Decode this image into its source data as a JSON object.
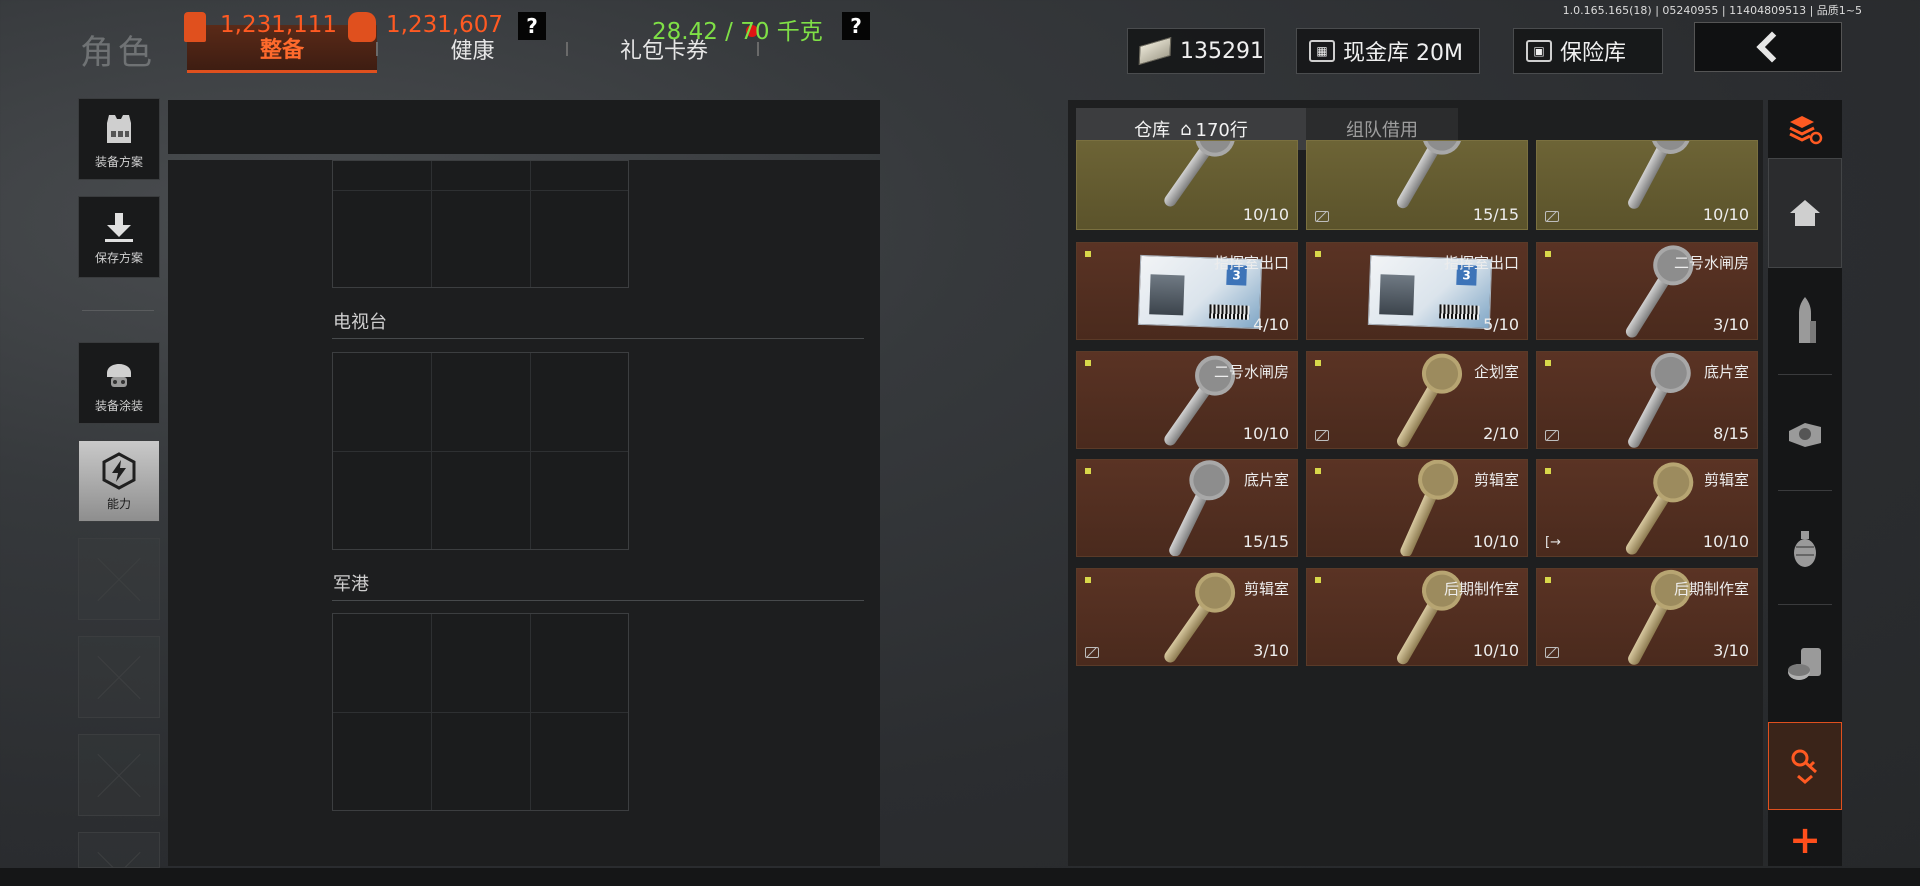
{
  "header": {
    "title": "角色",
    "tabs": [
      {
        "label": "整备",
        "active": true
      },
      {
        "label": "健康",
        "active": false
      },
      {
        "label": "礼包卡券",
        "active": false,
        "notification": true
      }
    ],
    "version": "1.0.165.165(18) | 05240955 | 11404809513 | 品质1~5",
    "currency": "135291",
    "cash_vault": "现金库 20M",
    "safe": "保险库"
  },
  "sidebar": {
    "items": [
      {
        "label": "装备方案",
        "icon": "vest-icon"
      },
      {
        "label": "保存方案",
        "icon": "download-icon"
      },
      {
        "label": "装备涂装",
        "icon": "helmet-icon"
      },
      {
        "label": "能力",
        "icon": "ability-icon",
        "active": true
      }
    ]
  },
  "stats": {
    "gear_value": "1,231,111",
    "bag_value": "1,231,607",
    "weight": "28.42 / 70 千克",
    "help": "?"
  },
  "loadout_sections": [
    {
      "label": "电视台"
    },
    {
      "label": "军港"
    }
  ],
  "warehouse": {
    "tab_storage": "仓库",
    "row_count": "170行",
    "tab_team": "组队借用",
    "items": [
      {
        "name": "",
        "count": "10/10",
        "style": "tan",
        "key": "silver",
        "badge": false
      },
      {
        "name": "",
        "count": "15/15",
        "style": "tan",
        "key": "silver",
        "badge": true
      },
      {
        "name": "",
        "count": "10/10",
        "style": "tan",
        "key": "silver",
        "badge": true
      },
      {
        "name": "指挥室出口",
        "count": "4/10",
        "style": "brown",
        "key": "card",
        "badge": false
      },
      {
        "name": "指挥室出口",
        "count": "5/10",
        "style": "brown",
        "key": "card",
        "badge": false
      },
      {
        "name": "二号水闸房",
        "count": "3/10",
        "style": "brown",
        "key": "silver",
        "badge": false
      },
      {
        "name": "二号水闸房",
        "count": "10/10",
        "style": "brown",
        "key": "silver",
        "badge": false
      },
      {
        "name": "企划室",
        "count": "2/10",
        "style": "brown",
        "key": "gold",
        "badge": true
      },
      {
        "name": "底片室",
        "count": "8/15",
        "style": "brown",
        "key": "silver",
        "badge": true
      },
      {
        "name": "底片室",
        "count": "15/15",
        "style": "brown",
        "key": "silver",
        "badge": false
      },
      {
        "name": "剪辑室",
        "count": "10/10",
        "style": "brown",
        "key": "gold",
        "badge": false
      },
      {
        "name": "剪辑室",
        "count": "10/10",
        "style": "brown",
        "key": "gold",
        "exit": true
      },
      {
        "name": "剪辑室",
        "count": "3/10",
        "style": "brown",
        "key": "gold",
        "badge": true
      },
      {
        "name": "后期制作室",
        "count": "10/10",
        "style": "brown",
        "key": "gold",
        "badge": false
      },
      {
        "name": "后期制作室",
        "count": "3/10",
        "style": "brown",
        "key": "gold",
        "badge": true
      }
    ]
  },
  "right_nav": {
    "items": [
      "swap-layers-icon",
      "home-icon",
      "ammo-icon",
      "sight-icon",
      "grenade-icon",
      "meds-icon",
      "key-import-icon"
    ],
    "add": "+"
  },
  "colors": {
    "accent": "#ff5a22",
    "weight_ok": "#7fe046",
    "item_key_bg": "#5a3324",
    "item_tan_bg": "#6d6436"
  }
}
